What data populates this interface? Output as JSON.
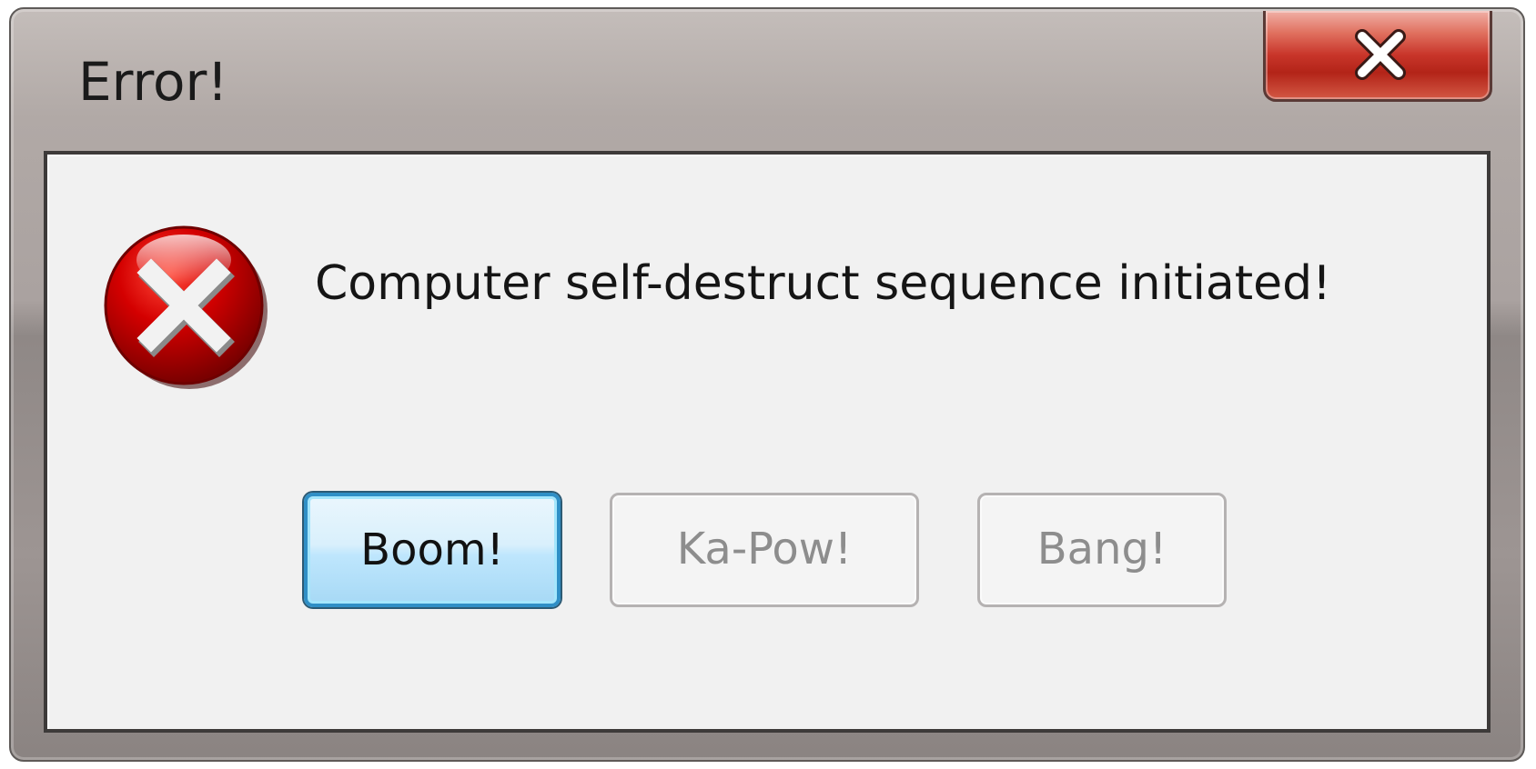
{
  "window": {
    "title": "Error!",
    "close_icon": "close-x-icon"
  },
  "dialog": {
    "icon": "error-icon",
    "message": "Computer self-destruct sequence initiated!"
  },
  "buttons": [
    {
      "label": "Boom!",
      "state": "default-focused"
    },
    {
      "label": "Ka-Pow!",
      "state": "disabled"
    },
    {
      "label": "Bang!",
      "state": "disabled"
    }
  ],
  "colors": {
    "error_red": "#d40000",
    "close_button_red": "#c8352a",
    "default_button_border": "#2f8fc6",
    "disabled_text": "#8d8d8d"
  }
}
